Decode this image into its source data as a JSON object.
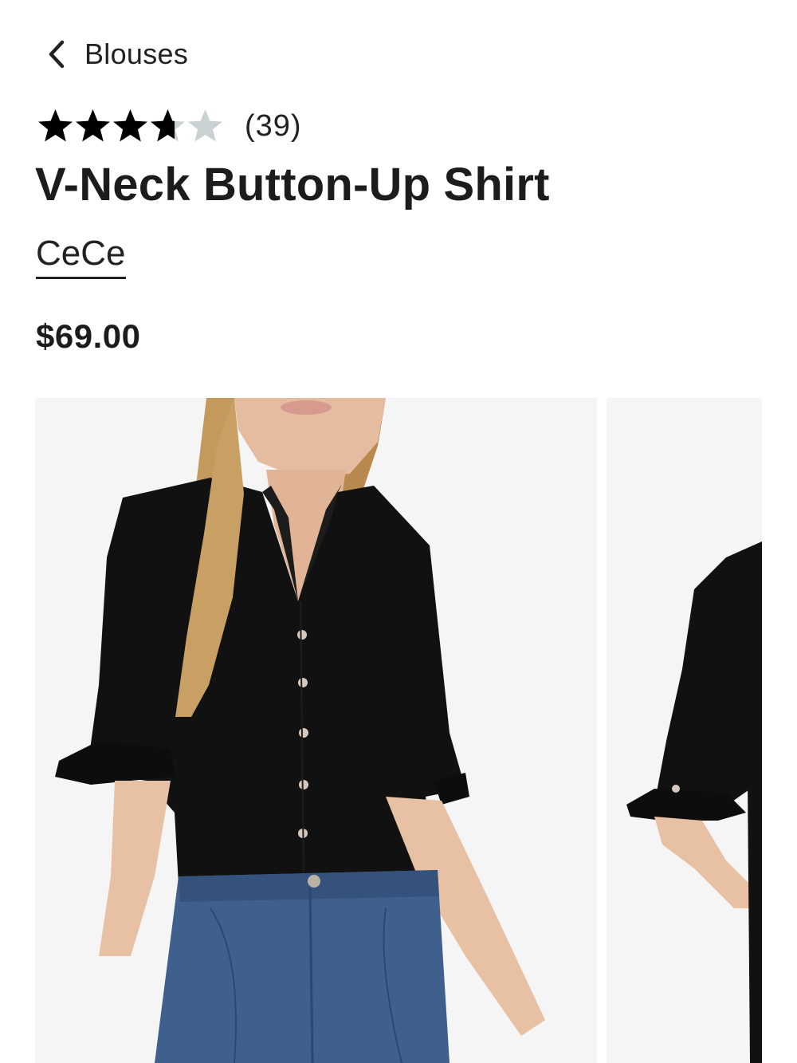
{
  "breadcrumb": {
    "label": "Blouses",
    "icon": "chevron-left-icon"
  },
  "rating": {
    "value": 3.7,
    "max": 5,
    "count_label": "(39)",
    "filled_color": "#000000",
    "empty_color": "#c9d1d3"
  },
  "product": {
    "title": "V-Neck Button-Up Shirt",
    "brand": "CeCe",
    "price": "$69.00"
  },
  "gallery": {
    "images": [
      {
        "name": "product-photo-front",
        "subject": "model wearing black v-neck button-up shirt with ruffle sleeves"
      },
      {
        "name": "product-photo-side",
        "subject": "side view of black shirt ruffle sleeve"
      }
    ],
    "background": "#f5f5f5"
  }
}
